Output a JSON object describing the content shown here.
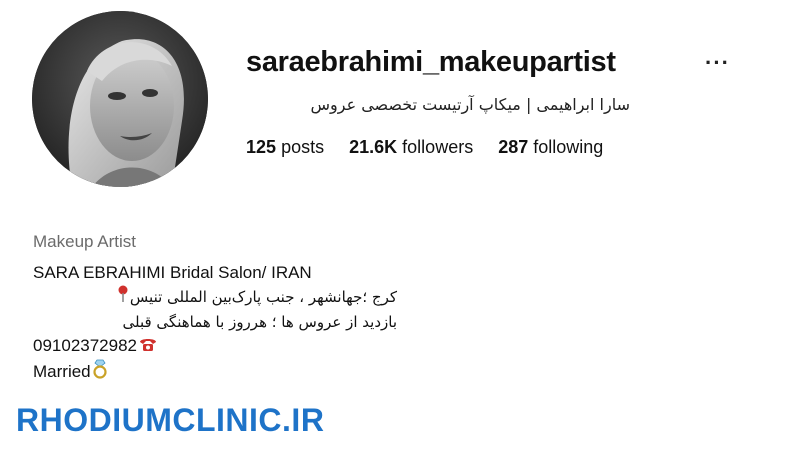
{
  "profile": {
    "username": "saraebrahimi_makeupartist",
    "more_label": "···",
    "full_name": "سارا ابراهیمی | میکاپ آرتیست تخصصی عروس",
    "stats": [
      {
        "count": "125",
        "label": "posts"
      },
      {
        "count": "21.6K",
        "label": "followers"
      },
      {
        "count": "287",
        "label": "following"
      }
    ],
    "avatar_icon": "profile-photo"
  },
  "bio": {
    "category": "Makeup Artist",
    "line1": "SARA EBRAHIMI Bridal Salon/ IRAN",
    "line2": "کرج ؛جهانشهر ، جنب پارک‌بین المللی تنیس",
    "line2_icon": "pin-icon",
    "line3": "بازدید از عروس ها ؛ هرروز با هماهنگی قبلی",
    "phone": "09102372982",
    "phone_icon": "phone-icon",
    "status": "Married",
    "status_icon": "ring-icon"
  },
  "watermark": "RHODIUMCLINIC.IR",
  "colors": {
    "watermark": "#1e73c8",
    "category": "#6b6b6b",
    "icon_red": "#d0312d"
  }
}
